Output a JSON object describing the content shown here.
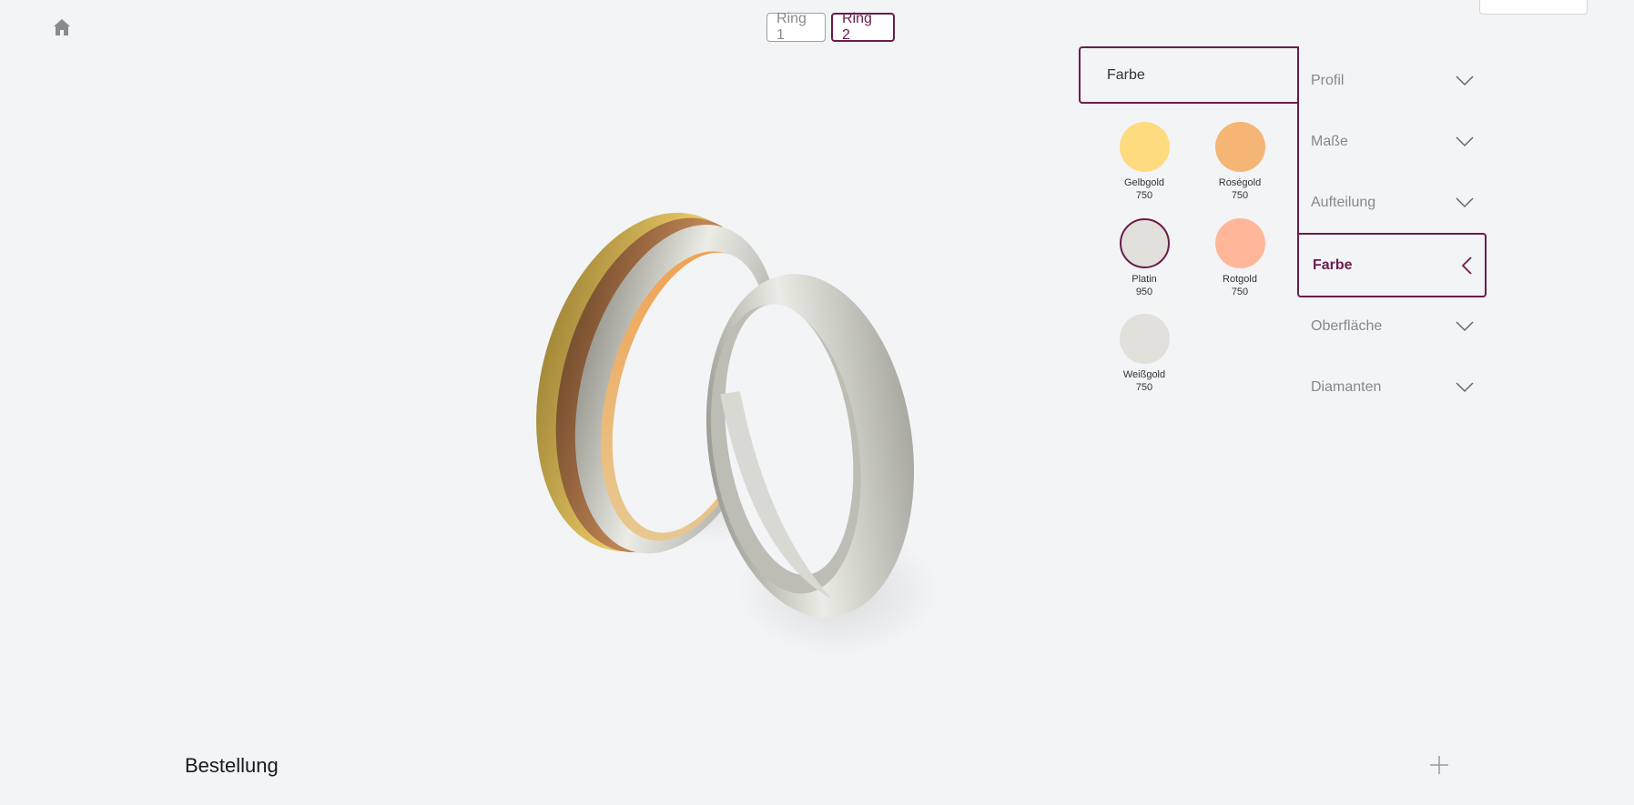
{
  "header": {
    "home_icon": "home-icon",
    "ring_tabs": [
      {
        "label": "Ring 1",
        "active": false
      },
      {
        "label": "Ring 2",
        "active": true
      }
    ]
  },
  "color_panel": {
    "title": "Farbe",
    "swatches": [
      {
        "name": "Gelbgold",
        "purity": "750",
        "color": "#ffdb80",
        "selected": false
      },
      {
        "name": "Roségold",
        "purity": "750",
        "color": "#f5b575",
        "selected": false
      },
      {
        "name": "Platin",
        "purity": "950",
        "color": "#e1e0da",
        "selected": true
      },
      {
        "name": "Rotgold",
        "purity": "750",
        "color": "#ffb699",
        "selected": false
      },
      {
        "name": "Weißgold",
        "purity": "750",
        "color": "#e1e0da",
        "selected": false
      }
    ]
  },
  "menu": {
    "items": [
      {
        "label": "Profil",
        "icon": "chevron-down-icon"
      },
      {
        "label": "Maße",
        "icon": "chevron-down-icon"
      },
      {
        "label": "Aufteilung",
        "icon": "chevron-down-icon"
      },
      {
        "label": "Farbe",
        "icon": "chevron-left-icon",
        "active": true
      },
      {
        "label": "Oberfläche",
        "icon": "chevron-down-icon"
      },
      {
        "label": "Diamanten",
        "icon": "chevron-down-icon"
      }
    ]
  },
  "order": {
    "title": "Bestellung",
    "add_icon": "plus-icon"
  },
  "colors": {
    "accent": "#6b1d4a",
    "background": "#f2f4f6"
  }
}
